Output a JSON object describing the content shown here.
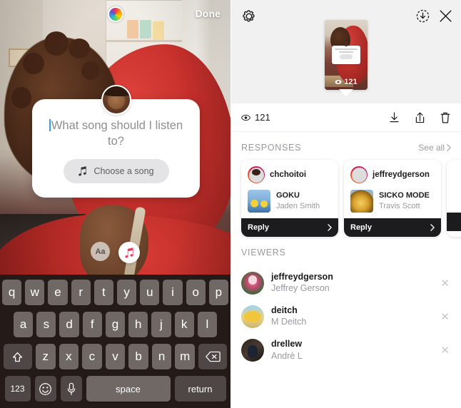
{
  "left": {
    "topbar": {
      "color_wheel_icon": "color-wheel-icon",
      "done_label": "Done"
    },
    "sticker": {
      "question_text": "What song should I listen to?",
      "choose_song_label": "Choose a song",
      "music_note_icon": "music-note-icon",
      "avatar_icon": "user-avatar"
    },
    "tools": {
      "text_tool_label": "Aa",
      "music_tool_icon": "music-note-icon"
    },
    "keyboard": {
      "row1": [
        "q",
        "w",
        "e",
        "r",
        "t",
        "y",
        "u",
        "i",
        "o",
        "p"
      ],
      "row2": [
        "a",
        "s",
        "d",
        "f",
        "g",
        "h",
        "j",
        "k",
        "l"
      ],
      "row3_letters": [
        "z",
        "x",
        "c",
        "v",
        "b",
        "n",
        "m"
      ],
      "shift_icon": "shift-icon",
      "backspace_icon": "backspace-icon",
      "numbers_label": "123",
      "emoji_icon": "emoji-icon",
      "mic_icon": "microphone-icon",
      "space_label": "space",
      "return_label": "return"
    }
  },
  "right": {
    "header": {
      "settings_icon": "gear-icon",
      "save_icon": "download-circle-icon",
      "close_icon": "close-icon",
      "thumbnail_view_count": "121",
      "thumbnail_eye_icon": "eye-icon"
    },
    "stats": {
      "eye_icon": "eye-icon",
      "view_count": "121",
      "download_icon": "download-icon",
      "share_icon": "share-icon",
      "delete_icon": "trash-icon"
    },
    "responses": {
      "section_title": "RESPONSES",
      "see_all_label": "See all",
      "chevron_icon": "chevron-right-icon",
      "reply_label": "Reply",
      "cards": [
        {
          "username": "chchoitoi",
          "song_title": "GOKU",
          "song_artist": "Jaden Smith",
          "reply_label": "Reply"
        },
        {
          "username": "jeffreydgerson",
          "song_title": "SICKO MODE",
          "song_artist": "Travis Scott",
          "reply_label": "Reply"
        }
      ]
    },
    "viewers": {
      "section_title": "VIEWERS",
      "remove_icon": "close-icon",
      "rows": [
        {
          "username": "jeffreydgerson",
          "fullname": "Jeffrey Gerson"
        },
        {
          "username": "deitch",
          "fullname": "M Deitch"
        },
        {
          "username": "drellew",
          "fullname": "Andrè L"
        }
      ]
    }
  },
  "colors": {
    "accent_blue": "#3897f0",
    "dark": "#1c1c1e",
    "muted": "#9a9a9f",
    "keyboard_bg": "#241b19",
    "key_bg": "#6f6865"
  }
}
